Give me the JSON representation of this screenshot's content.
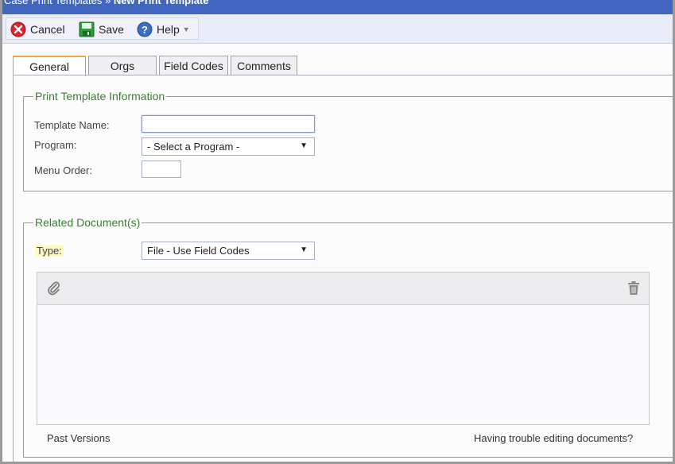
{
  "title": {
    "parent": "Case Print Templates",
    "separator": "»",
    "current": "New Print Template"
  },
  "toolbar": {
    "cancel_label": "Cancel",
    "save_label": "Save",
    "help_label": "Help"
  },
  "tabs": [
    {
      "label": "General",
      "active": true
    },
    {
      "label": "Orgs",
      "active": false
    },
    {
      "label": "Field Codes",
      "active": false
    },
    {
      "label": "Comments",
      "active": false
    }
  ],
  "info": {
    "legend": "Print Template Information",
    "template_name_label": "Template Name:",
    "template_name_value": "",
    "program_label": "Program:",
    "program_selected": "- Select a Program -",
    "menu_order_label": "Menu Order:",
    "menu_order_value": ""
  },
  "docs": {
    "legend": "Related Document(s)",
    "type_label": "Type:",
    "type_selected": "File - Use Field Codes",
    "past_versions": "Past Versions",
    "trouble_link": "Having trouble editing documents?"
  },
  "colors": {
    "title_bar": "#4066c2",
    "legend": "#3a7d32",
    "active_tab": "#f1a64a",
    "type_highlight": "#fbf9c8"
  },
  "icons": {
    "cancel": "cancel-icon",
    "save": "save-icon",
    "help": "help-icon",
    "attach": "paperclip-icon",
    "delete": "trash-icon"
  }
}
